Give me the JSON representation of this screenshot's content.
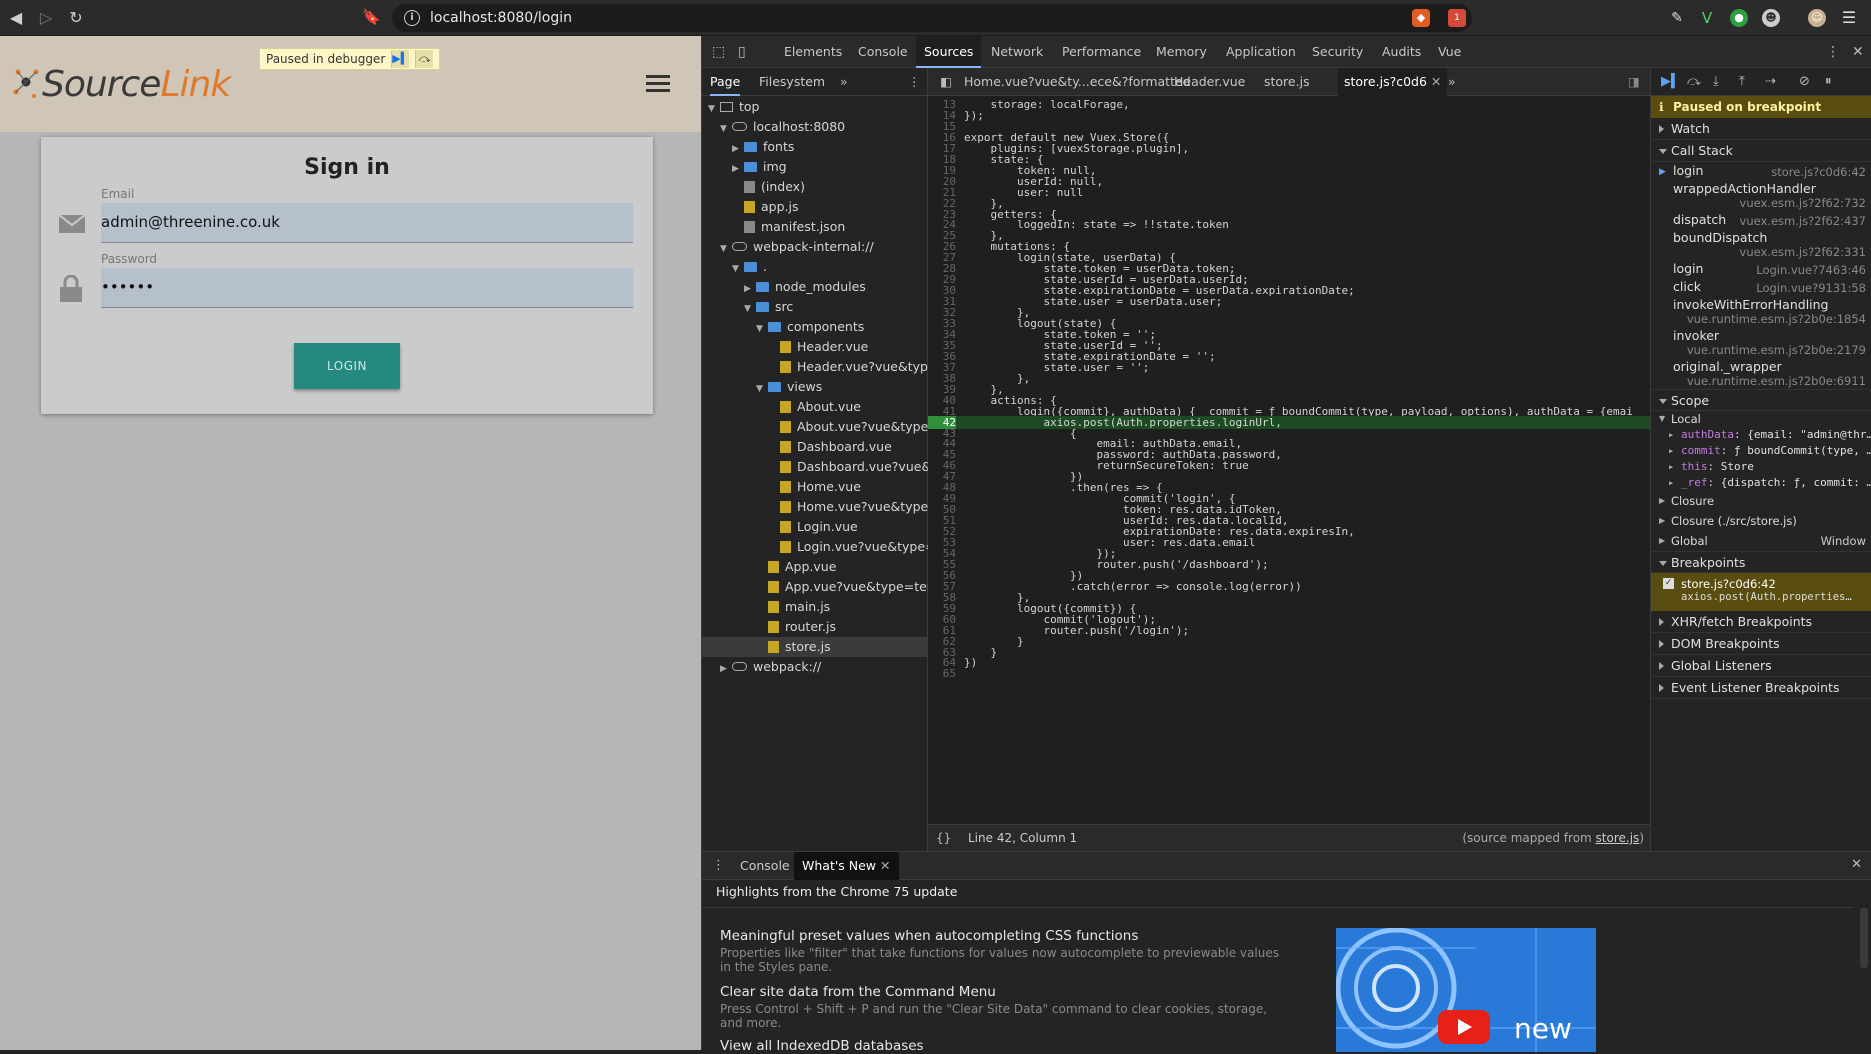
{
  "browser": {
    "url": "localhost:8080/login",
    "back_icon": "arrow-left",
    "forward_icon": "arrow-right",
    "reload_icon": "reload",
    "notification_count": "1"
  },
  "app": {
    "logo_text_1": "Source",
    "logo_text_2": "Link",
    "paused_label": "Paused in debugger",
    "signin_title": "Sign in",
    "email_label": "Email",
    "email_value": "admin@threenine.co.uk",
    "password_label": "Password",
    "password_value": "••••••",
    "login_button": "LOGIN"
  },
  "devtools": {
    "tabs": [
      "Elements",
      "Console",
      "Sources",
      "Network",
      "Performance",
      "Memory",
      "Application",
      "Security",
      "Audits",
      "Vue"
    ],
    "active_tab": "Sources",
    "navigator": {
      "tabs": [
        "Page",
        "Filesystem"
      ],
      "tree": [
        {
          "label": "top",
          "indent": 0,
          "icon": "frame",
          "arrow": "open"
        },
        {
          "label": "localhost:8080",
          "indent": 1,
          "icon": "cloud",
          "arrow": "open"
        },
        {
          "label": "fonts",
          "indent": 2,
          "icon": "folder",
          "arrow": "closed"
        },
        {
          "label": "img",
          "indent": 2,
          "icon": "folder",
          "arrow": "closed"
        },
        {
          "label": "(index)",
          "indent": 2,
          "icon": "file-gray",
          "arrow": ""
        },
        {
          "label": "app.js",
          "indent": 2,
          "icon": "file",
          "arrow": ""
        },
        {
          "label": "manifest.json",
          "indent": 2,
          "icon": "file-gray",
          "arrow": ""
        },
        {
          "label": "webpack-internal://",
          "indent": 1,
          "icon": "cloud",
          "arrow": "open"
        },
        {
          "label": ".",
          "indent": 2,
          "icon": "folder",
          "arrow": "open"
        },
        {
          "label": "node_modules",
          "indent": 3,
          "icon": "folder",
          "arrow": "closed"
        },
        {
          "label": "src",
          "indent": 3,
          "icon": "folder",
          "arrow": "open"
        },
        {
          "label": "components",
          "indent": 4,
          "icon": "folder",
          "arrow": "open"
        },
        {
          "label": "Header.vue",
          "indent": 5,
          "icon": "file",
          "arrow": ""
        },
        {
          "label": "Header.vue?vue&type=t",
          "indent": 5,
          "icon": "file",
          "arrow": ""
        },
        {
          "label": "views",
          "indent": 4,
          "icon": "folder",
          "arrow": "open"
        },
        {
          "label": "About.vue",
          "indent": 5,
          "icon": "file",
          "arrow": ""
        },
        {
          "label": "About.vue?vue&type=te",
          "indent": 5,
          "icon": "file",
          "arrow": ""
        },
        {
          "label": "Dashboard.vue",
          "indent": 5,
          "icon": "file",
          "arrow": ""
        },
        {
          "label": "Dashboard.vue?vue&typ",
          "indent": 5,
          "icon": "file",
          "arrow": ""
        },
        {
          "label": "Home.vue",
          "indent": 5,
          "icon": "file",
          "arrow": ""
        },
        {
          "label": "Home.vue?vue&type=te",
          "indent": 5,
          "icon": "file",
          "arrow": ""
        },
        {
          "label": "Login.vue",
          "indent": 5,
          "icon": "file",
          "arrow": ""
        },
        {
          "label": "Login.vue?vue&type=te",
          "indent": 5,
          "icon": "file",
          "arrow": ""
        },
        {
          "label": "App.vue",
          "indent": 4,
          "icon": "file",
          "arrow": ""
        },
        {
          "label": "App.vue?vue&type=templ",
          "indent": 4,
          "icon": "file",
          "arrow": ""
        },
        {
          "label": "main.js",
          "indent": 4,
          "icon": "file",
          "arrow": ""
        },
        {
          "label": "router.js",
          "indent": 4,
          "icon": "file",
          "arrow": ""
        },
        {
          "label": "store.js",
          "indent": 4,
          "icon": "file",
          "arrow": "",
          "selected": true
        },
        {
          "label": "webpack://",
          "indent": 1,
          "icon": "cloud",
          "arrow": "closed"
        }
      ]
    },
    "editor": {
      "tabs": [
        "Home.vue?vue&ty...ece&?formatted",
        "Header.vue",
        "store.js",
        "store.js?c0d6"
      ],
      "active_tab": "store.js?c0d6",
      "exec_line": 42,
      "lines": [
        {
          "n": 13,
          "t": "    storage: localForage,"
        },
        {
          "n": 14,
          "t": "});"
        },
        {
          "n": 15,
          "t": ""
        },
        {
          "n": 16,
          "t": "export default new Vuex.Store({"
        },
        {
          "n": 17,
          "t": "    plugins: [vuexStorage.plugin],"
        },
        {
          "n": 18,
          "t": "    state: {"
        },
        {
          "n": 19,
          "t": "        token: null,"
        },
        {
          "n": 20,
          "t": "        userId: null,"
        },
        {
          "n": 21,
          "t": "        user: null"
        },
        {
          "n": 22,
          "t": "    },"
        },
        {
          "n": 23,
          "t": "    getters: {"
        },
        {
          "n": 24,
          "t": "        loggedIn: state => !!state.token"
        },
        {
          "n": 25,
          "t": "    },"
        },
        {
          "n": 26,
          "t": "    mutations: {"
        },
        {
          "n": 27,
          "t": "        login(state, userData) {"
        },
        {
          "n": 28,
          "t": "            state.token = userData.token;"
        },
        {
          "n": 29,
          "t": "            state.userId = userData.userId;"
        },
        {
          "n": 30,
          "t": "            state.expirationDate = userData.expirationDate;"
        },
        {
          "n": 31,
          "t": "            state.user = userData.user;"
        },
        {
          "n": 32,
          "t": "        },"
        },
        {
          "n": 33,
          "t": "        logout(state) {"
        },
        {
          "n": 34,
          "t": "            state.token = '';"
        },
        {
          "n": 35,
          "t": "            state.userId = '';"
        },
        {
          "n": 36,
          "t": "            state.expirationDate = '';"
        },
        {
          "n": 37,
          "t": "            state.user = '';"
        },
        {
          "n": 38,
          "t": "        },"
        },
        {
          "n": 39,
          "t": "    },"
        },
        {
          "n": 40,
          "t": "    actions: {"
        },
        {
          "n": 41,
          "t": "        login({commit}, authData) {  commit = ƒ boundCommit(type, payload, options), authData = {emai"
        },
        {
          "n": 42,
          "t": "            axios.post(Auth.properties.loginUrl,"
        },
        {
          "n": 43,
          "t": "                {"
        },
        {
          "n": 44,
          "t": "                    email: authData.email,"
        },
        {
          "n": 45,
          "t": "                    password: authData.password,"
        },
        {
          "n": 46,
          "t": "                    returnSecureToken: true"
        },
        {
          "n": 47,
          "t": "                })"
        },
        {
          "n": 48,
          "t": "                .then(res => {"
        },
        {
          "n": 49,
          "t": "                        commit('login', {"
        },
        {
          "n": 50,
          "t": "                        token: res.data.idToken,"
        },
        {
          "n": 51,
          "t": "                        userId: res.data.localId,"
        },
        {
          "n": 52,
          "t": "                        expirationDate: res.data.expiresIn,"
        },
        {
          "n": 53,
          "t": "                        user: res.data.email"
        },
        {
          "n": 54,
          "t": "                    });"
        },
        {
          "n": 55,
          "t": "                    router.push('/dashboard');"
        },
        {
          "n": 56,
          "t": "                })"
        },
        {
          "n": 57,
          "t": "                .catch(error => console.log(error))"
        },
        {
          "n": 58,
          "t": "        },"
        },
        {
          "n": 59,
          "t": "        logout({commit}) {"
        },
        {
          "n": 60,
          "t": "            commit('logout');"
        },
        {
          "n": 61,
          "t": "            router.push('/login');"
        },
        {
          "n": 62,
          "t": "        }"
        },
        {
          "n": 63,
          "t": "    }"
        },
        {
          "n": 64,
          "t": "})"
        },
        {
          "n": 65,
          "t": ""
        }
      ],
      "status_position": "Line 42, Column 1",
      "status_source_prefix": "(source mapped from ",
      "status_source_link": "store.js",
      "status_source_suffix": ")"
    },
    "debugger": {
      "paused_label": "Paused on breakpoint",
      "watch_label": "Watch",
      "callstack_label": "Call Stack",
      "callstack": [
        {
          "fn": "login",
          "loc": "store.js?c0d6:42",
          "active": true,
          "wrap": false
        },
        {
          "fn": "wrappedActionHandler",
          "loc": "vuex.esm.js?2f62:732",
          "wrap": true
        },
        {
          "fn": "dispatch",
          "loc": "vuex.esm.js?2f62:437",
          "wrap": false
        },
        {
          "fn": "boundDispatch",
          "loc": "vuex.esm.js?2f62:331",
          "wrap": true
        },
        {
          "fn": "login",
          "loc": "Login.vue?7463:46",
          "wrap": false
        },
        {
          "fn": "click",
          "loc": "Login.vue?9131:58",
          "wrap": false
        },
        {
          "fn": "invokeWithErrorHandling",
          "loc": "vue.runtime.esm.js?2b0e:1854",
          "wrap": true
        },
        {
          "fn": "invoker",
          "loc": "vue.runtime.esm.js?2b0e:2179",
          "wrap": true
        },
        {
          "fn": "original._wrapper",
          "loc": "vue.runtime.esm.js?2b0e:6911",
          "wrap": true
        }
      ],
      "scope_label": "Scope",
      "local_label": "Local",
      "scope_vars": [
        {
          "name": "authData",
          "val": "{email: \"admin@thr…"
        },
        {
          "name": "commit",
          "val": "ƒ boundCommit(type, …"
        },
        {
          "name": "this",
          "val": "Store"
        },
        {
          "name": "_ref",
          "val": "{dispatch: ƒ, commit: …"
        }
      ],
      "closure_label": "Closure",
      "closure2_label": "Closure (./src/store.js)",
      "global_label": "Global",
      "global_value": "Window",
      "breakpoints_label": "Breakpoints",
      "breakpoint_file": "store.js?c0d6:42",
      "breakpoint_code": "axios.post(Auth.properties…",
      "xhr_label": "XHR/fetch Breakpoints",
      "dom_label": "DOM Breakpoints",
      "global_listeners_label": "Global Listeners",
      "event_listener_label": "Event Listener Breakpoints"
    },
    "drawer": {
      "tabs": [
        "Console",
        "What's New"
      ],
      "active_tab": "What's New",
      "headline": "Highlights from the Chrome 75 update",
      "items": [
        {
          "title": "Meaningful preset values when autocompleting CSS functions",
          "desc": "Properties like \"filter\" that take functions for values now autocomplete to previewable values in the Styles pane."
        },
        {
          "title": "Clear site data from the Command Menu",
          "desc": "Press Control + Shift + P and run the \"Clear Site Data\" command to clear cookies, storage, and more."
        },
        {
          "title": "View all IndexedDB databases",
          "desc": ""
        }
      ],
      "video_text": "new"
    }
  }
}
